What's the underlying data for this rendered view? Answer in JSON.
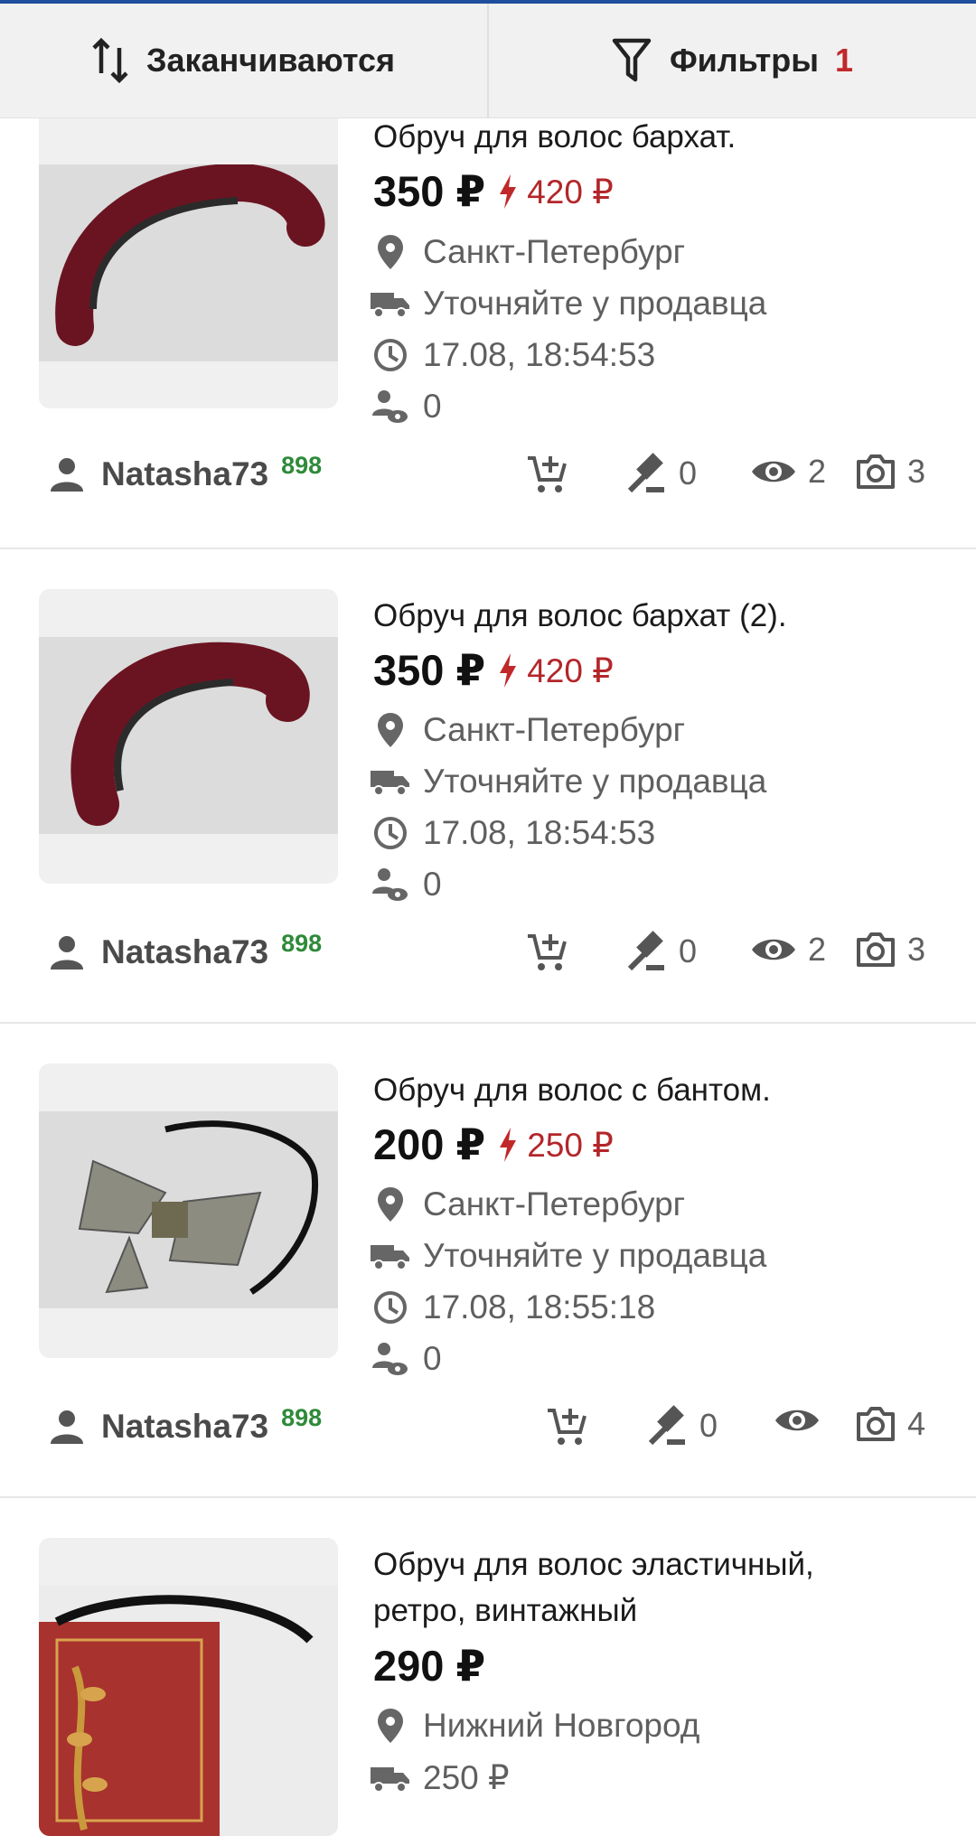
{
  "toolbar": {
    "sort_label": "Заканчиваются",
    "filters_label": "Фильтры",
    "filters_count": "1"
  },
  "listings": [
    {
      "title": "Обруч для волос бархат.",
      "price": "350 ₽",
      "old_price": "420 ₽",
      "city": "Санкт-Петербург",
      "delivery": "Уточняйте у продавца",
      "date": "17.08, 18:54:53",
      "watchers": "0",
      "seller": "Natasha73",
      "rating": "898",
      "bids": "0",
      "views": "2",
      "photos": "3"
    },
    {
      "title": "Обруч для волос бархат (2).",
      "price": "350 ₽",
      "old_price": "420 ₽",
      "city": "Санкт-Петербург",
      "delivery": "Уточняйте у продавца",
      "date": "17.08, 18:54:53",
      "watchers": "0",
      "seller": "Natasha73",
      "rating": "898",
      "bids": "0",
      "views": "2",
      "photos": "3"
    },
    {
      "title": "Обруч для волос с бантом.",
      "price": "200 ₽",
      "old_price": "250 ₽",
      "city": "Санкт-Петербург",
      "delivery": "Уточняйте у продавца",
      "date": "17.08, 18:55:18",
      "watchers": "0",
      "seller": "Natasha73",
      "rating": "898",
      "bids": "0",
      "photos": "4"
    },
    {
      "title_line1": "Обруч для волос эластичный,",
      "title_line2": "ретро, винтажный",
      "price": "290 ₽",
      "city": "Нижний Новгород",
      "delivery": "250 ₽"
    }
  ],
  "colors": {
    "accent_blue": "#1f4f9c",
    "price_red": "#b3262a",
    "rating_green": "#2f8a3a"
  },
  "icons": [
    "sort-icon",
    "filter-icon",
    "location-pin-icon",
    "delivery-truck-icon",
    "clock-icon",
    "watchers-icon",
    "user-icon",
    "add-to-cart-icon",
    "gavel-icon",
    "eye-icon",
    "camera-icon",
    "lightning-icon"
  ]
}
